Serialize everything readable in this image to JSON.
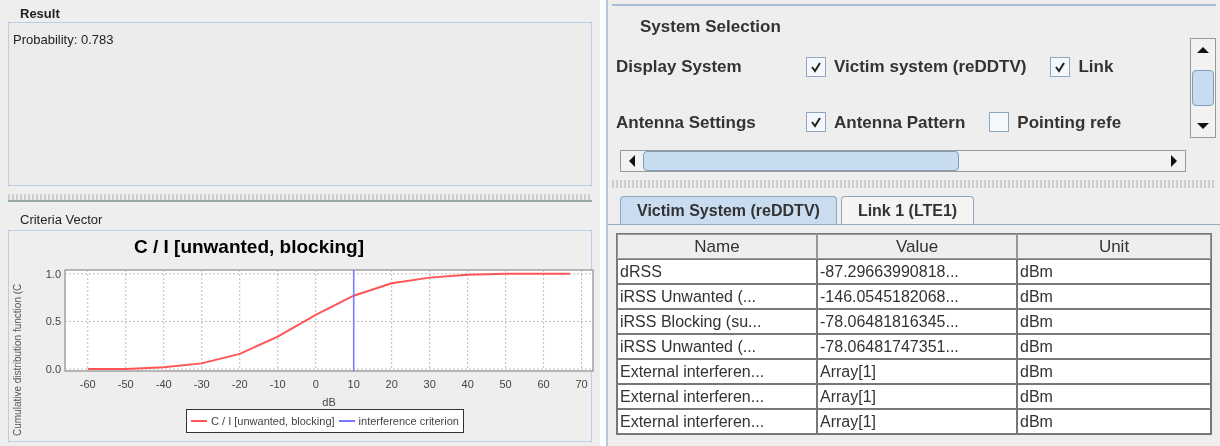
{
  "result_panel": {
    "title": "Result",
    "text": "Probability: 0.783"
  },
  "criteria_panel": {
    "title": "Criteria Vector",
    "chart_data": {
      "type": "line",
      "title": "C / I [unwanted, blocking]",
      "xlabel": "dB",
      "ylabel": "Cumulative distribution function (C",
      "x": [
        -60,
        -50,
        -40,
        -30,
        -20,
        -10,
        0,
        10,
        20,
        30,
        40,
        50,
        60,
        67
      ],
      "series": [
        {
          "name": "C / I [unwanted, blocking]",
          "color": "#ff5555",
          "values": [
            0,
            0,
            0.02,
            0.06,
            0.16,
            0.34,
            0.57,
            0.77,
            0.9,
            0.96,
            0.99,
            1,
            1,
            1
          ]
        }
      ],
      "xlim": [
        -66,
        73
      ],
      "ylim": [
        -0.02,
        1.04
      ],
      "xticks": [
        -60,
        -50,
        -40,
        -30,
        -20,
        -10,
        0,
        10,
        20,
        30,
        40,
        50,
        60,
        70
      ],
      "yticks": [
        {
          "value": 0,
          "label": "0.0"
        },
        {
          "value": 0.5,
          "label": "0.5"
        },
        {
          "value": 1,
          "label": "1.0"
        }
      ],
      "grid": true,
      "legend": "bottom",
      "ref_lines": [
        {
          "axis": "x",
          "value": 10,
          "label": "interference criterion",
          "color": "#7777ff"
        }
      ]
    }
  },
  "system_selection": {
    "title": "System Selection",
    "rows": [
      {
        "label": "Display System",
        "options": [
          {
            "label": "Victim system (reDDTV)",
            "checked": true
          },
          {
            "label": "Link",
            "checked": true
          }
        ]
      },
      {
        "label": "Antenna Settings",
        "options": [
          {
            "label": "Antenna Pattern",
            "checked": true
          },
          {
            "label": "Pointing refe",
            "checked": false
          }
        ]
      }
    ]
  },
  "tabs": [
    {
      "label": "Victim System (reDDTV)",
      "selected": true
    },
    {
      "label": "Link 1 (LTE1)",
      "selected": false
    }
  ],
  "table": {
    "columns": [
      "Name",
      "Value",
      "Unit"
    ],
    "rows": [
      [
        "dRSS",
        "-87.29663990818...",
        "dBm"
      ],
      [
        "iRSS Unwanted (...",
        "-146.0545182068...",
        "dBm"
      ],
      [
        "iRSS Blocking (su...",
        "-78.06481816345...",
        "dBm"
      ],
      [
        "iRSS Unwanted (...",
        "-78.06481747351...",
        "dBm"
      ],
      [
        "External interferen...",
        "Array[1]",
        "dBm"
      ],
      [
        "External interferen...",
        "Array[1]",
        "dBm"
      ],
      [
        "External interferen...",
        "Array[1]",
        "dBm"
      ]
    ]
  }
}
